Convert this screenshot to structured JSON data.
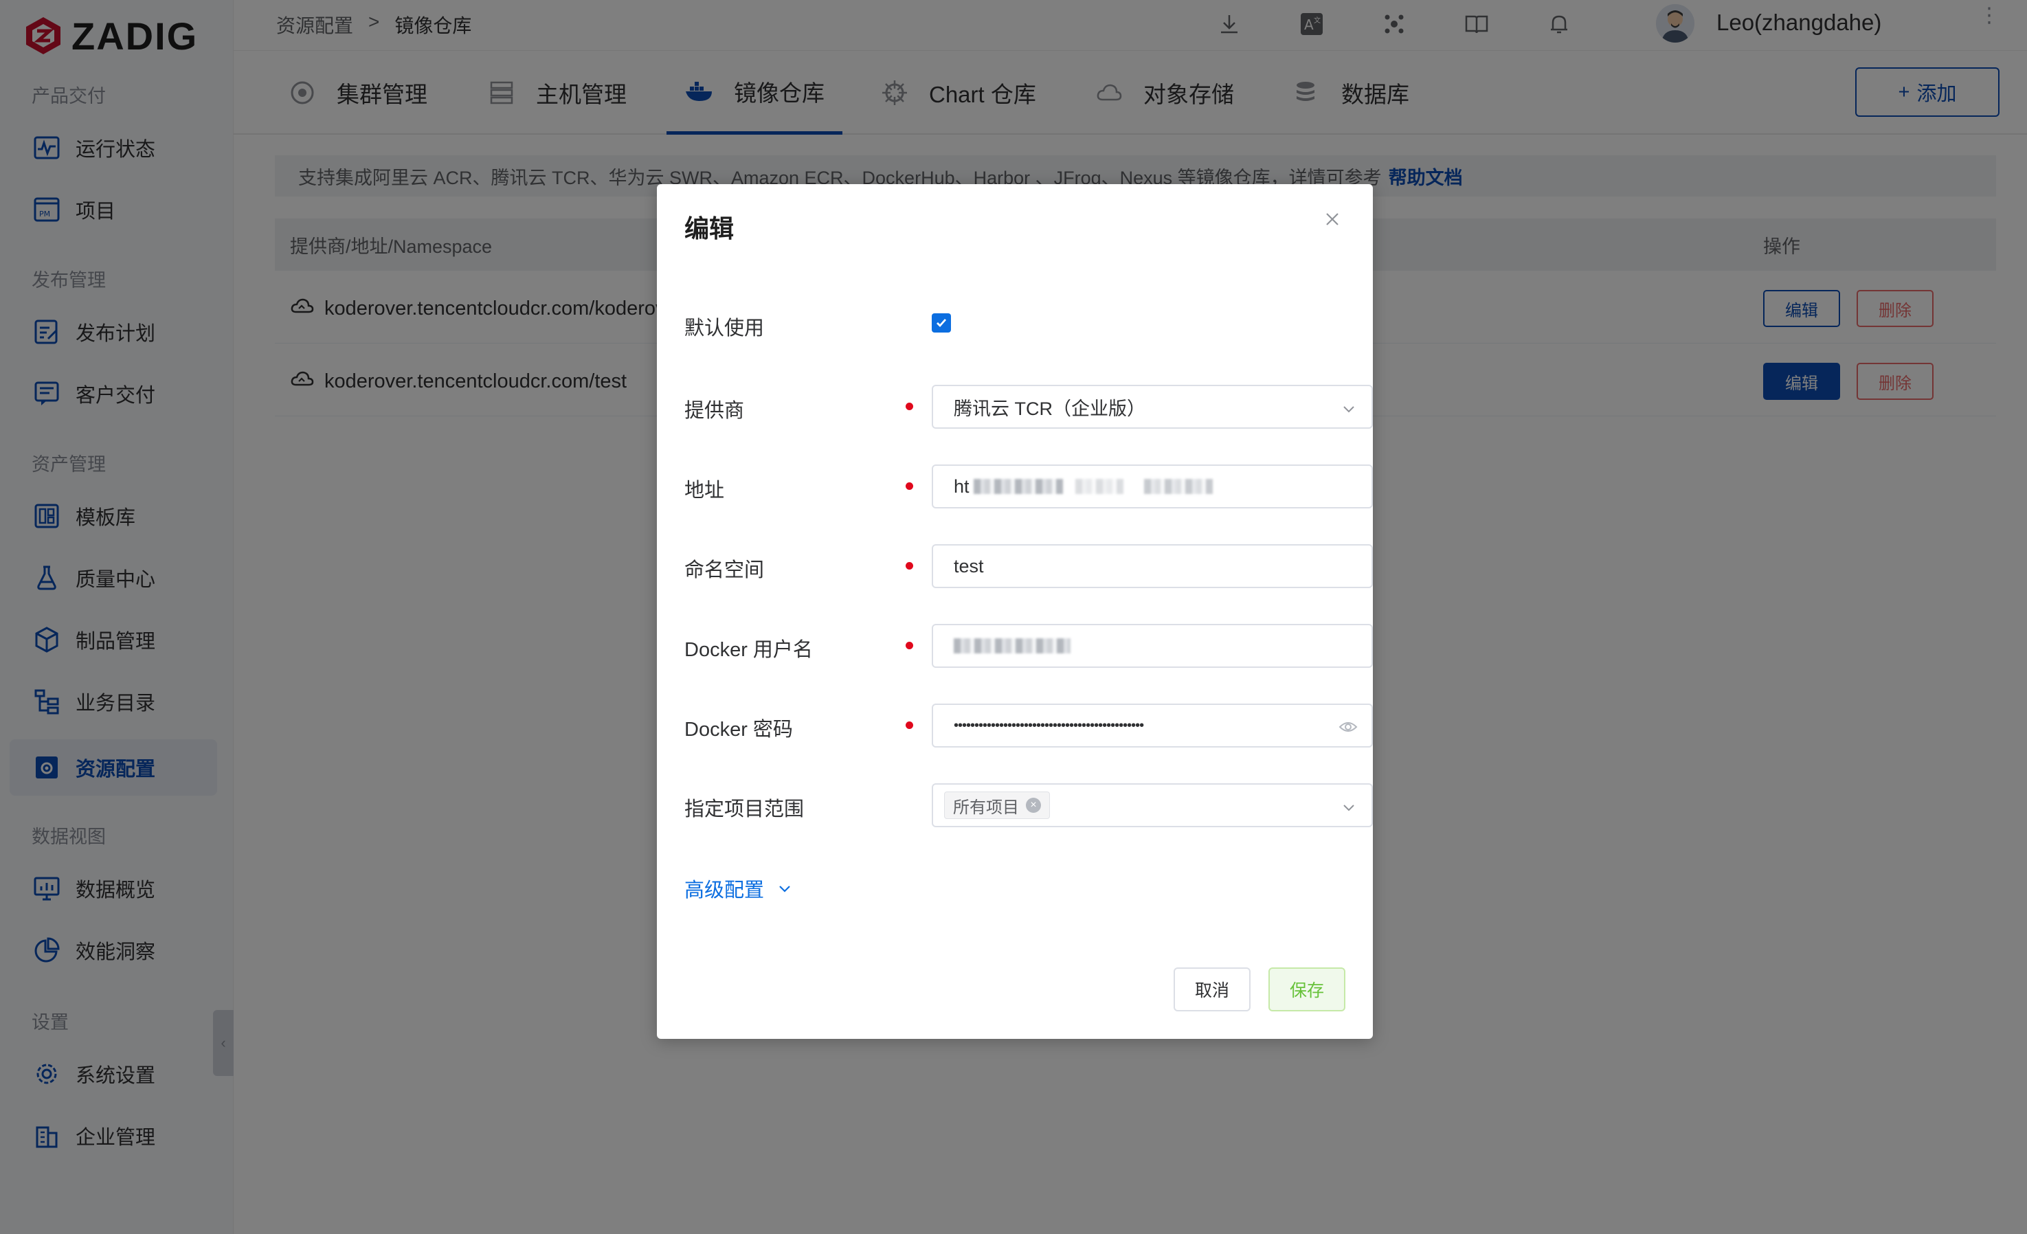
{
  "app": {
    "logo_text": "ZADIG"
  },
  "sidebar": {
    "groups": [
      {
        "label": "产品交付",
        "items": [
          {
            "label": "运行状态",
            "icon": "pulse-monitor-icon"
          },
          {
            "label": "项目",
            "icon": "project-icon"
          }
        ]
      },
      {
        "label": "发布管理",
        "items": [
          {
            "label": "发布计划",
            "icon": "release-plan-icon"
          },
          {
            "label": "客户交付",
            "icon": "customer-delivery-icon"
          }
        ]
      },
      {
        "label": "资产管理",
        "items": [
          {
            "label": "模板库",
            "icon": "template-icon"
          },
          {
            "label": "质量中心",
            "icon": "flask-icon"
          },
          {
            "label": "制品管理",
            "icon": "package-icon"
          },
          {
            "label": "业务目录",
            "icon": "catalog-icon"
          },
          {
            "label": "资源配置",
            "icon": "resource-config-icon",
            "active": true
          }
        ]
      },
      {
        "label": "数据视图",
        "items": [
          {
            "label": "数据概览",
            "icon": "dashboard-icon"
          },
          {
            "label": "效能洞察",
            "icon": "pie-chart-icon"
          }
        ]
      },
      {
        "label": "设置",
        "items": [
          {
            "label": "系统设置",
            "icon": "gear-icon"
          },
          {
            "label": "企业管理",
            "icon": "building-icon"
          }
        ]
      }
    ]
  },
  "header": {
    "breadcrumb": {
      "parent": "资源配置",
      "separator": ">",
      "current": "镜像仓库"
    },
    "username": "Leo(zhangdahe)"
  },
  "tabs": [
    {
      "label": "集群管理",
      "icon": "cluster-icon"
    },
    {
      "label": "主机管理",
      "icon": "server-icon"
    },
    {
      "label": "镜像仓库",
      "icon": "docker-icon",
      "active": true
    },
    {
      "label": "Chart 仓库",
      "icon": "helm-icon"
    },
    {
      "label": "对象存储",
      "icon": "cloud-icon"
    },
    {
      "label": "数据库",
      "icon": "database-icon"
    }
  ],
  "add_button": {
    "icon_text": "+",
    "label": "添加"
  },
  "notice": {
    "text": "支持集成阿里云 ACR、腾讯云 TCR、华为云 SWR、Amazon ECR、DockerHub、Harbor 、JFrog、Nexus 等镜像仓库，详情可参考",
    "link": "帮助文档"
  },
  "table": {
    "columns": {
      "provider": "提供商/地址/Namespace",
      "actions": "操作"
    },
    "rows": [
      {
        "address": "koderover.tencentcloudcr.com/koderove",
        "edit": "编辑",
        "delete": "删除"
      },
      {
        "address": "koderover.tencentcloudcr.com/test",
        "edit": "编辑",
        "delete": "删除"
      }
    ]
  },
  "modal": {
    "title": "编辑",
    "fields": {
      "default_label": "默认使用",
      "default_checked": true,
      "provider_label": "提供商",
      "provider_value": "腾讯云 TCR（企业版）",
      "address_label": "地址",
      "address_prefix": "ht",
      "namespace_label": "命名空间",
      "namespace_value": "test",
      "username_label": "Docker 用户名",
      "password_label": "Docker 密码",
      "password_value": "••••••••••••••••••••••••••••••••••••••••••••••",
      "scope_label": "指定项目范围",
      "scope_tag": "所有项目"
    },
    "advanced": "高级配置",
    "cancel": "取消",
    "save": "保存"
  },
  "colors": {
    "primary": "#0c4db5",
    "link": "#0c6ee0",
    "danger": "#e96b6b",
    "required": "#e0081c",
    "success": "#67c23a",
    "brand": "#c8102e"
  }
}
